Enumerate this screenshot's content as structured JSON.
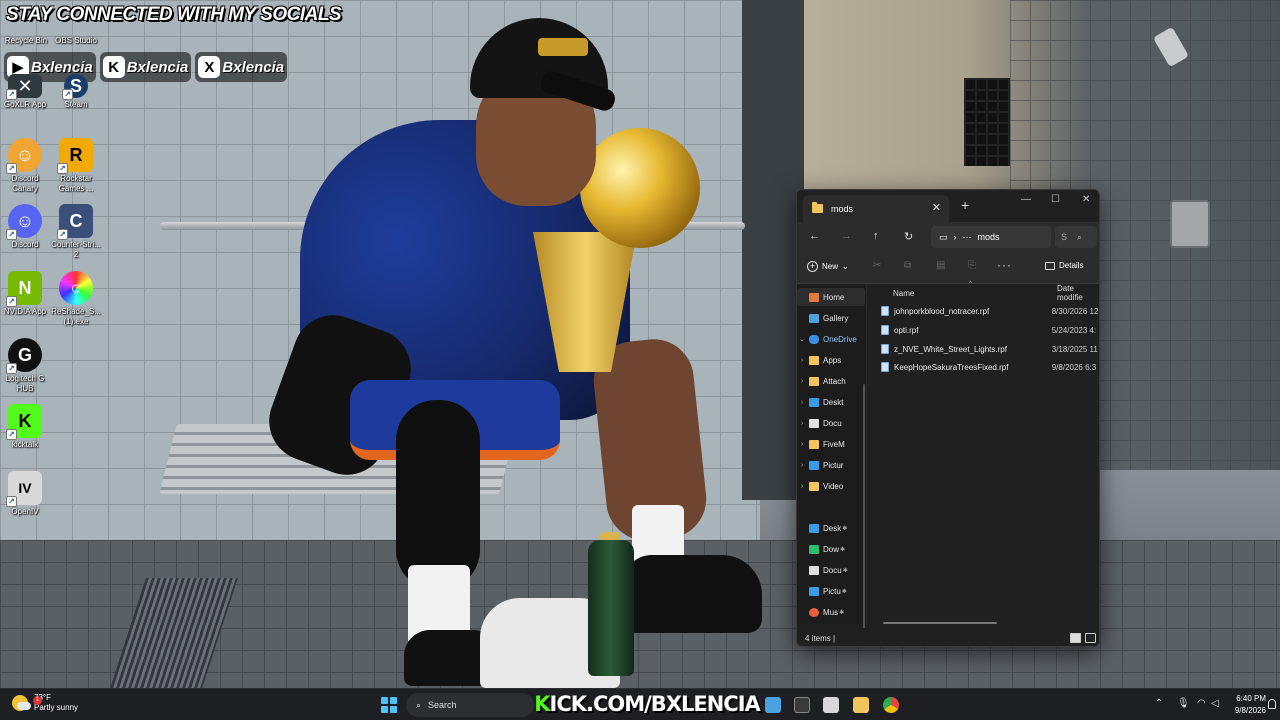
{
  "desktop": {
    "banner": {
      "title": "STAY CONNECTED WITH MY SOCIALS",
      "socials": [
        {
          "platform_icon": "youtube-icon",
          "glyph": "▶",
          "handle": "Bxlencia",
          "color": "#ffffff"
        },
        {
          "platform_icon": "kick-icon",
          "glyph": "K",
          "handle": "Bxlencia",
          "color": "#ffffff"
        },
        {
          "platform_icon": "x-icon",
          "glyph": "X",
          "handle": "Bxlencia",
          "color": "#ffffff"
        }
      ]
    },
    "icons": [
      {
        "label": "Recycle Bin"
      },
      {
        "label": "OBS Studio"
      },
      {
        "label": "GoXLR App",
        "glyph": "✕",
        "color": "#2f3a3f"
      },
      {
        "label": "Steam",
        "glyph": "S",
        "color": "#1b3d6b"
      },
      {
        "label": "Discord\nCanary",
        "glyph": "☺",
        "color": "#f0a532"
      },
      {
        "label": "Rockstar\nGames ...",
        "glyph": "R",
        "color": "#f2a900"
      },
      {
        "label": "Discord",
        "glyph": "☺",
        "color": "#5865f2"
      },
      {
        "label": "Counter-Stri...\n2",
        "glyph": "C",
        "color": "#3a4f7a"
      },
      {
        "label": "NVIDIA App",
        "glyph": "N",
        "color": "#76b900"
      },
      {
        "label": "ReShade_S...\n(1).exe",
        "glyph": "○",
        "color": "#ffffff"
      },
      {
        "label": "Logitech G\nHUB",
        "glyph": "G",
        "color": "#111111"
      },
      {
        "label": "kicktalk",
        "glyph": "K",
        "color": "#53fc18"
      },
      {
        "label": "OpenIV",
        "glyph": "IV",
        "color": "#d9d9d9"
      }
    ]
  },
  "explorer": {
    "tab_title": "mods",
    "new_tab_glyph": "+",
    "address": "mods",
    "address_more": "···",
    "search_glyph": "⌕",
    "search_text": "S",
    "toolbar": {
      "new_label": "New",
      "more_glyph": "···",
      "details_label": "Details"
    },
    "nav": [
      {
        "label": "Home",
        "icon": "home-icon",
        "color": "#e07b39",
        "active": true,
        "chevron": ""
      },
      {
        "label": "Gallery",
        "icon": "gallery-icon",
        "color": "#4aa3e0",
        "chevron": ""
      },
      {
        "label": "OneDrive",
        "icon": "onedrive-icon",
        "color": "#3a8ee6",
        "chevron": "⌄",
        "label_color": "#8fc8ff"
      },
      {
        "label": "Apps",
        "icon": "folder-icon",
        "color": "#f2c55c",
        "chevron": "›"
      },
      {
        "label": "Attach",
        "icon": "folder-icon",
        "color": "#f2c55c",
        "chevron": "›"
      },
      {
        "label": "Deskt",
        "icon": "desktop-folder-icon",
        "color": "#3a9be8",
        "chevron": "›"
      },
      {
        "label": "Docu",
        "icon": "documents-icon",
        "color": "#e0e0e0",
        "chevron": "›"
      },
      {
        "label": "FiveM",
        "icon": "folder-icon",
        "color": "#f2c55c",
        "chevron": "›"
      },
      {
        "label": "Pictur",
        "icon": "pictures-icon",
        "color": "#3a9be8",
        "chevron": "›"
      },
      {
        "label": "Video",
        "icon": "folder-icon",
        "color": "#f2c55c",
        "chevron": "›"
      },
      {
        "label": "Desk",
        "icon": "desktop-icon",
        "color": "#3a9be8",
        "pinned": true
      },
      {
        "label": "Dow",
        "icon": "downloads-icon",
        "color": "#2ebd6b",
        "pinned": true
      },
      {
        "label": "Docu",
        "icon": "documents-icon",
        "color": "#e0e0e0",
        "pinned": true
      },
      {
        "label": "Pictu",
        "icon": "pictures-icon",
        "color": "#3a9be8",
        "pinned": true
      },
      {
        "label": "Mus",
        "icon": "music-icon",
        "color": "#e8603c",
        "pinned": true
      }
    ],
    "columns": {
      "name": "Name",
      "date": "Date modifie"
    },
    "files": [
      {
        "name": "johnporkblood_notracer.rpf",
        "date": "8/30/2026 12"
      },
      {
        "name": "opti.rpf",
        "date": "5/24/2023 4:"
      },
      {
        "name": "z_NVE_White_Street_Lights.rpf",
        "date": "3/18/2025 11"
      },
      {
        "name": "KeepHopeSakuraTreesFixed.rpf",
        "date": "9/8/2026 6:3"
      }
    ],
    "status": "4 items  |"
  },
  "taskbar": {
    "weather": {
      "temp": "73°F",
      "condition": "Partly sunny",
      "badge": "1"
    },
    "search_label": "Search",
    "banner": "KICK.COM/BXLENCIA",
    "clock": {
      "time": "6:40 PM",
      "date": "9/8/2026"
    },
    "tray_up": "⌃",
    "apps": [
      {
        "name": "photos-app-icon",
        "color": "#4aa3e0"
      },
      {
        "name": "terminal-app-icon",
        "color": "#3b3b3b"
      },
      {
        "name": "notepad-app-icon",
        "color": "#d8d8d8"
      },
      {
        "name": "file-explorer-app-icon",
        "color": "#f2c55c"
      },
      {
        "name": "chrome-app-icon",
        "color": "#e8453c"
      }
    ]
  }
}
